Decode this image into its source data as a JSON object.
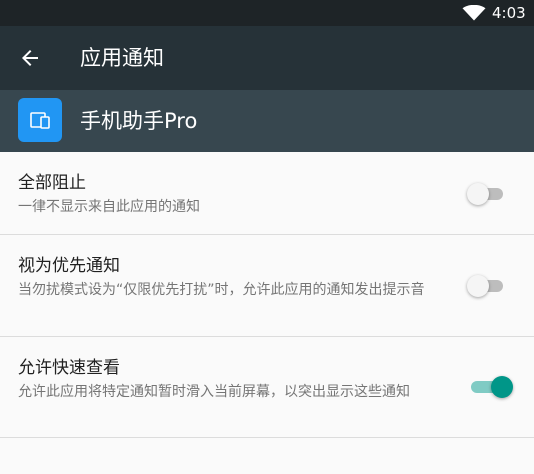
{
  "status_bar": {
    "time": "4:03",
    "wifi_icon": "wifi-icon"
  },
  "toolbar": {
    "back_icon": "arrow-left-icon",
    "title": "应用通知"
  },
  "app": {
    "icon": "phone-assistant-app-icon",
    "name": "手机助手Pro",
    "icon_color": "#2196f3"
  },
  "settings": [
    {
      "title": "全部阻止",
      "subtitle": "一律不显示来自此应用的通知",
      "enabled": false
    },
    {
      "title": "视为优先通知",
      "subtitle": "当勿扰模式设为“仅限优先打扰”时，允许此应用的通知发出提示音",
      "enabled": false
    },
    {
      "title": "允许快速查看",
      "subtitle": "允许此应用将特定通知暂时滑入当前屏幕，以突出显示这些通知",
      "enabled": true
    }
  ],
  "colors": {
    "toolbar": "#263238",
    "status_bar": "#1e2427",
    "app_header": "#37474f",
    "accent": "#009688"
  }
}
